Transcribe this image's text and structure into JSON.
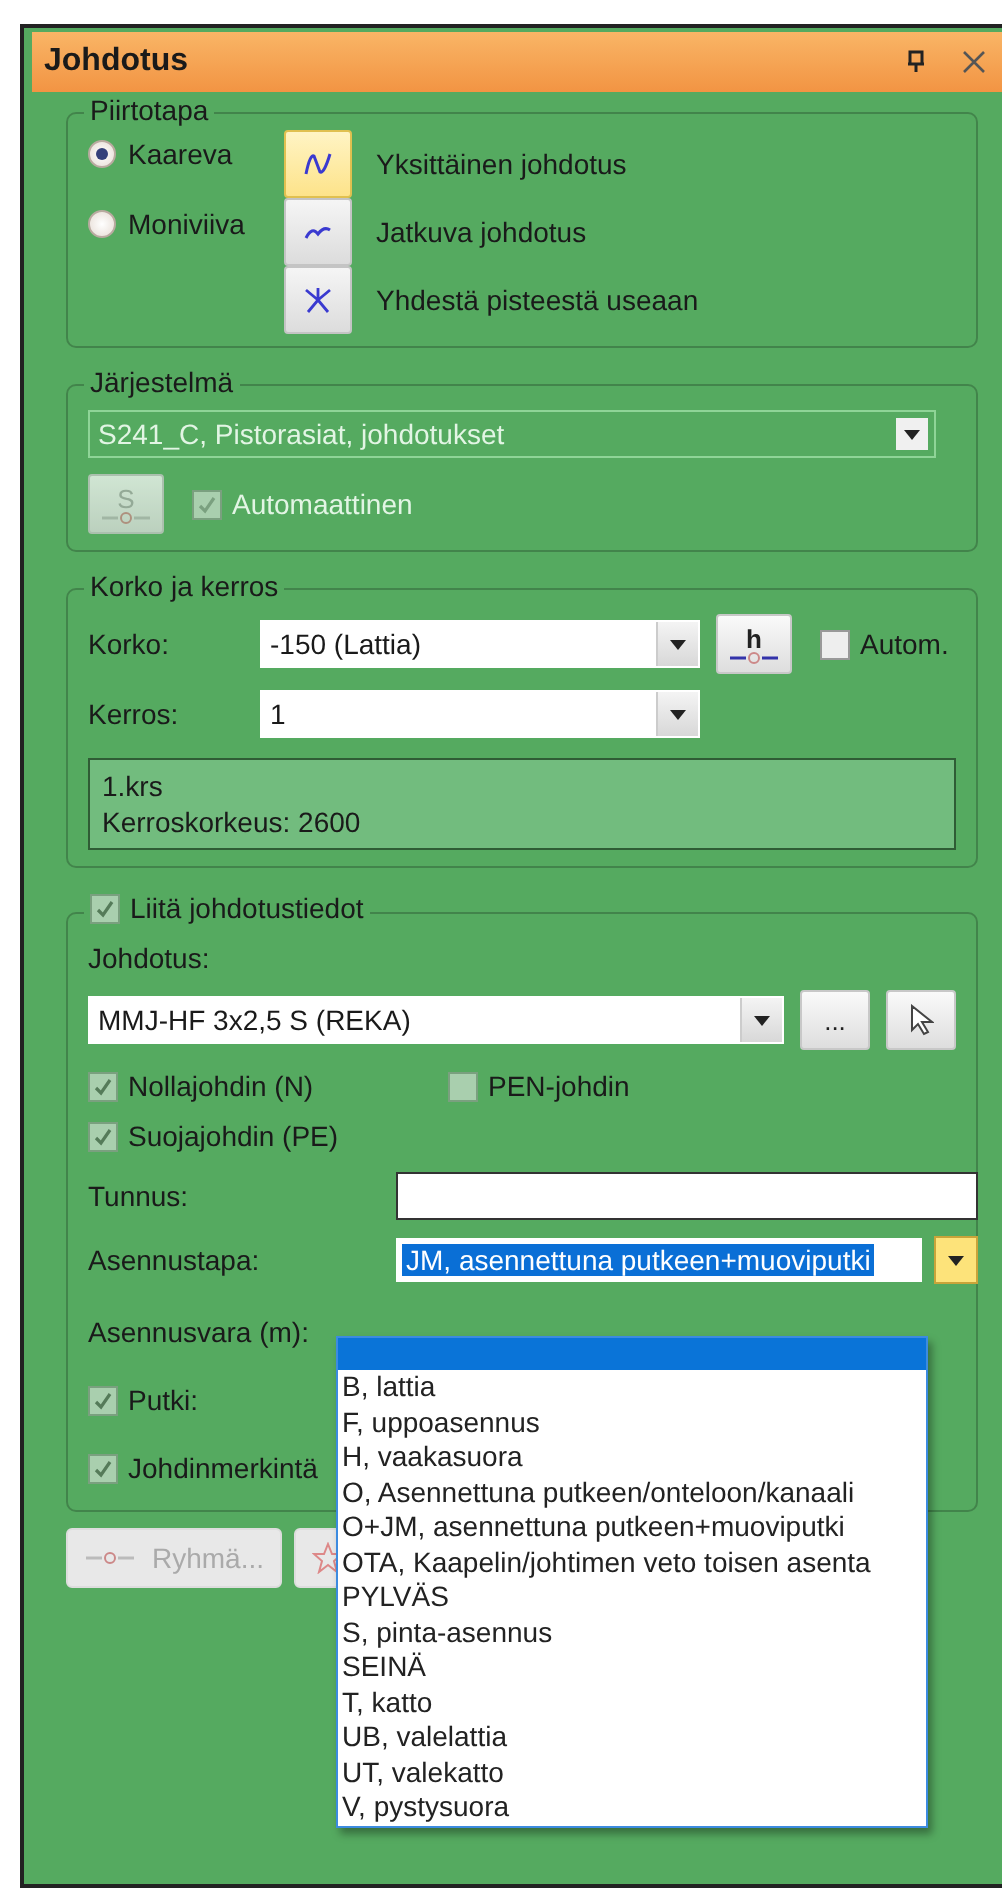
{
  "window": {
    "title": "Johdotus"
  },
  "drawing": {
    "title": "Piirtotapa",
    "modes": [
      {
        "label": "Kaareva",
        "selected": true
      },
      {
        "label": "Moniviiva",
        "selected": false
      }
    ],
    "styles": [
      {
        "label": "Yksittäinen johdotus",
        "selected": true,
        "kind": "single"
      },
      {
        "label": "Jatkuva johdotus",
        "selected": false,
        "kind": "continuous"
      },
      {
        "label": "Yhdestä pisteestä useaan",
        "selected": false,
        "kind": "star"
      }
    ]
  },
  "system": {
    "title": "Järjestelmä",
    "value": "S241_C, Pistorasiat, johdotukset",
    "disabled": true,
    "button": "S",
    "automatic": {
      "label": "Automaattinen",
      "checked": true
    }
  },
  "height": {
    "title": "Korko ja kerros",
    "height_label": "Korko:",
    "height_value": "-150 (Lattia)",
    "height_button": "h",
    "auto": {
      "label": "Autom.",
      "checked": false
    },
    "floor_label": "Kerros:",
    "floor_value": "1",
    "info": [
      "1.krs",
      "Kerroskorkeus: 2600"
    ]
  },
  "wiring": {
    "attach": {
      "label": "Liitä johdotustiedot",
      "checked": true
    },
    "cable_label": "Johdotus:",
    "cable_value": "MMJ-HF 3x2,5 S (REKA)",
    "more_button": "...",
    "conductors": [
      {
        "label": "Nollajohdin (N)",
        "checked": true
      },
      {
        "label": "PEN-johdin",
        "checked": false
      },
      {
        "label": "Suojajohdin (PE)",
        "checked": true
      }
    ],
    "id_label": "Tunnus:",
    "method_label": "Asennustapa:",
    "method_value": "JM, asennettuna putkeen+muoviputki",
    "method_open": true,
    "method_options": [
      {
        "label": "B, lattia",
        "selected": false
      },
      {
        "label": "F, uppoasennus",
        "selected": false
      },
      {
        "label": "H, vaakasuora",
        "selected": false
      },
      {
        "label": "O, Asennettuna putkeen/onteloon/kanaali",
        "selected": false
      },
      {
        "label": "O+JM, asennettuna putkeen+muoviputki",
        "selected": false
      },
      {
        "label": "OTA, Kaapelin/johtimen veto toisen asenta",
        "selected": false
      },
      {
        "label": "PYLVÄS",
        "selected": false
      },
      {
        "label": "S, pinta-asennus",
        "selected": false
      },
      {
        "label": "SEINÄ",
        "selected": false
      },
      {
        "label": "T, katto",
        "selected": false
      },
      {
        "label": "UB, valelattia",
        "selected": false
      },
      {
        "label": "UT, valekatto",
        "selected": false
      },
      {
        "label": "V, pystysuora",
        "selected": false
      }
    ],
    "reserve_label": "Asennusvara (m):",
    "pipe": {
      "label": "Putki:",
      "checked": true
    },
    "marking": {
      "label": "Johdinmerkintä",
      "checked": true
    }
  },
  "footer": {
    "group_button": "Ryhmä...",
    "group_disabled": true
  }
}
